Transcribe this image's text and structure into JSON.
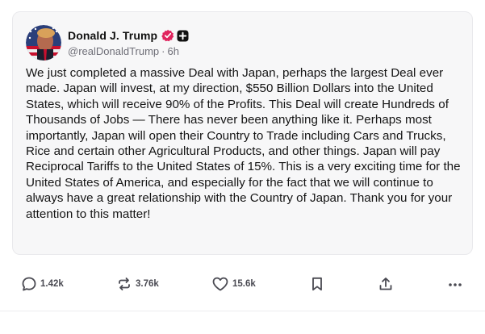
{
  "post": {
    "author": {
      "display_name": "Donald J. Trump",
      "handle": "@realDonaldTrump",
      "time_ago": "6h",
      "separator": "·",
      "verified_icon": "verified-badge-icon",
      "extra_badge_icon": "plus-badge-icon"
    },
    "text": "We just completed a massive Deal with Japan, perhaps the largest Deal ever made. Japan will invest, at my direction, $550 Billion Dollars into the United States, which will receive 90% of the Profits. This Deal will create Hundreds of Thousands of Jobs — There has never been anything like it. Perhaps most importantly, Japan will open their Country to Trade including Cars and Trucks, Rice and certain other Agricultural Products, and other things. Japan will pay Reciprocal Tariffs to the United States of 15%. This is a very exciting time for the United States of America, and especially for the fact that we will continue to always have a great relationship with the Country of Japan. Thank you for your attention to this matter!"
  },
  "actions": {
    "replies": {
      "icon": "reply-icon",
      "count": "1.42k"
    },
    "reposts": {
      "icon": "repost-icon",
      "count": "3.76k"
    },
    "likes": {
      "icon": "heart-icon",
      "count": "15.6k"
    },
    "bookmark": {
      "icon": "bookmark-icon"
    },
    "share": {
      "icon": "share-icon"
    },
    "more": {
      "icon": "more-icon"
    }
  },
  "colors": {
    "card_background": "#f7f7f8",
    "verified_badge": "#e0245e",
    "text": "#151515",
    "muted": "#6f6f78"
  }
}
